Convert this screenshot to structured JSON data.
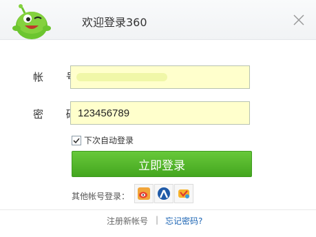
{
  "header": {
    "title": "欢迎登录360"
  },
  "form": {
    "account_label": "帐 号",
    "account_value": "",
    "password_label": "密 码",
    "password_value": "123456789",
    "auto_login_label": "下次自动登录",
    "auto_login_checked": true,
    "login_button": "立即登录"
  },
  "other_login": {
    "label": "其他帐号登录：",
    "providers": [
      "weibo-icon",
      "renren-icon",
      "tencent-icon"
    ]
  },
  "footer": {
    "register": "注册新帐号",
    "separator": "|",
    "forgot": "忘记密码?"
  },
  "colors": {
    "brand_green": "#44a61f",
    "input_bg": "#ffffcc",
    "link_blue": "#1a63b3"
  }
}
